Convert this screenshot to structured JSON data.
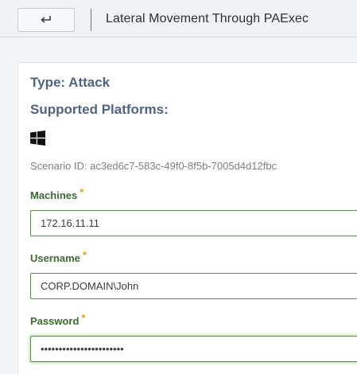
{
  "header": {
    "back_icon": "return-arrow-icon",
    "title": "Lateral Movement Through PAExec"
  },
  "details": {
    "type": "Type: Attack",
    "platforms_label": "Supported Platforms:",
    "platform_icon": "windows-icon",
    "scenario_id": "Scenario ID: ac3ed6c7-583c-49f0-8f5b-7005d4d12fbc"
  },
  "form": {
    "required_mark": "*",
    "machines": {
      "label": "Machines",
      "value": "172.16.11.11"
    },
    "username": {
      "label": "Username",
      "value": "CORP.DOMAIN\\John"
    },
    "password": {
      "label": "Password",
      "value": "•••••••••••••••••••••••"
    }
  },
  "colors": {
    "accent_green": "#5d8a52",
    "label_green": "#3b6b31",
    "heading_blue": "#4f6384",
    "required_orange": "#e0a21b"
  }
}
